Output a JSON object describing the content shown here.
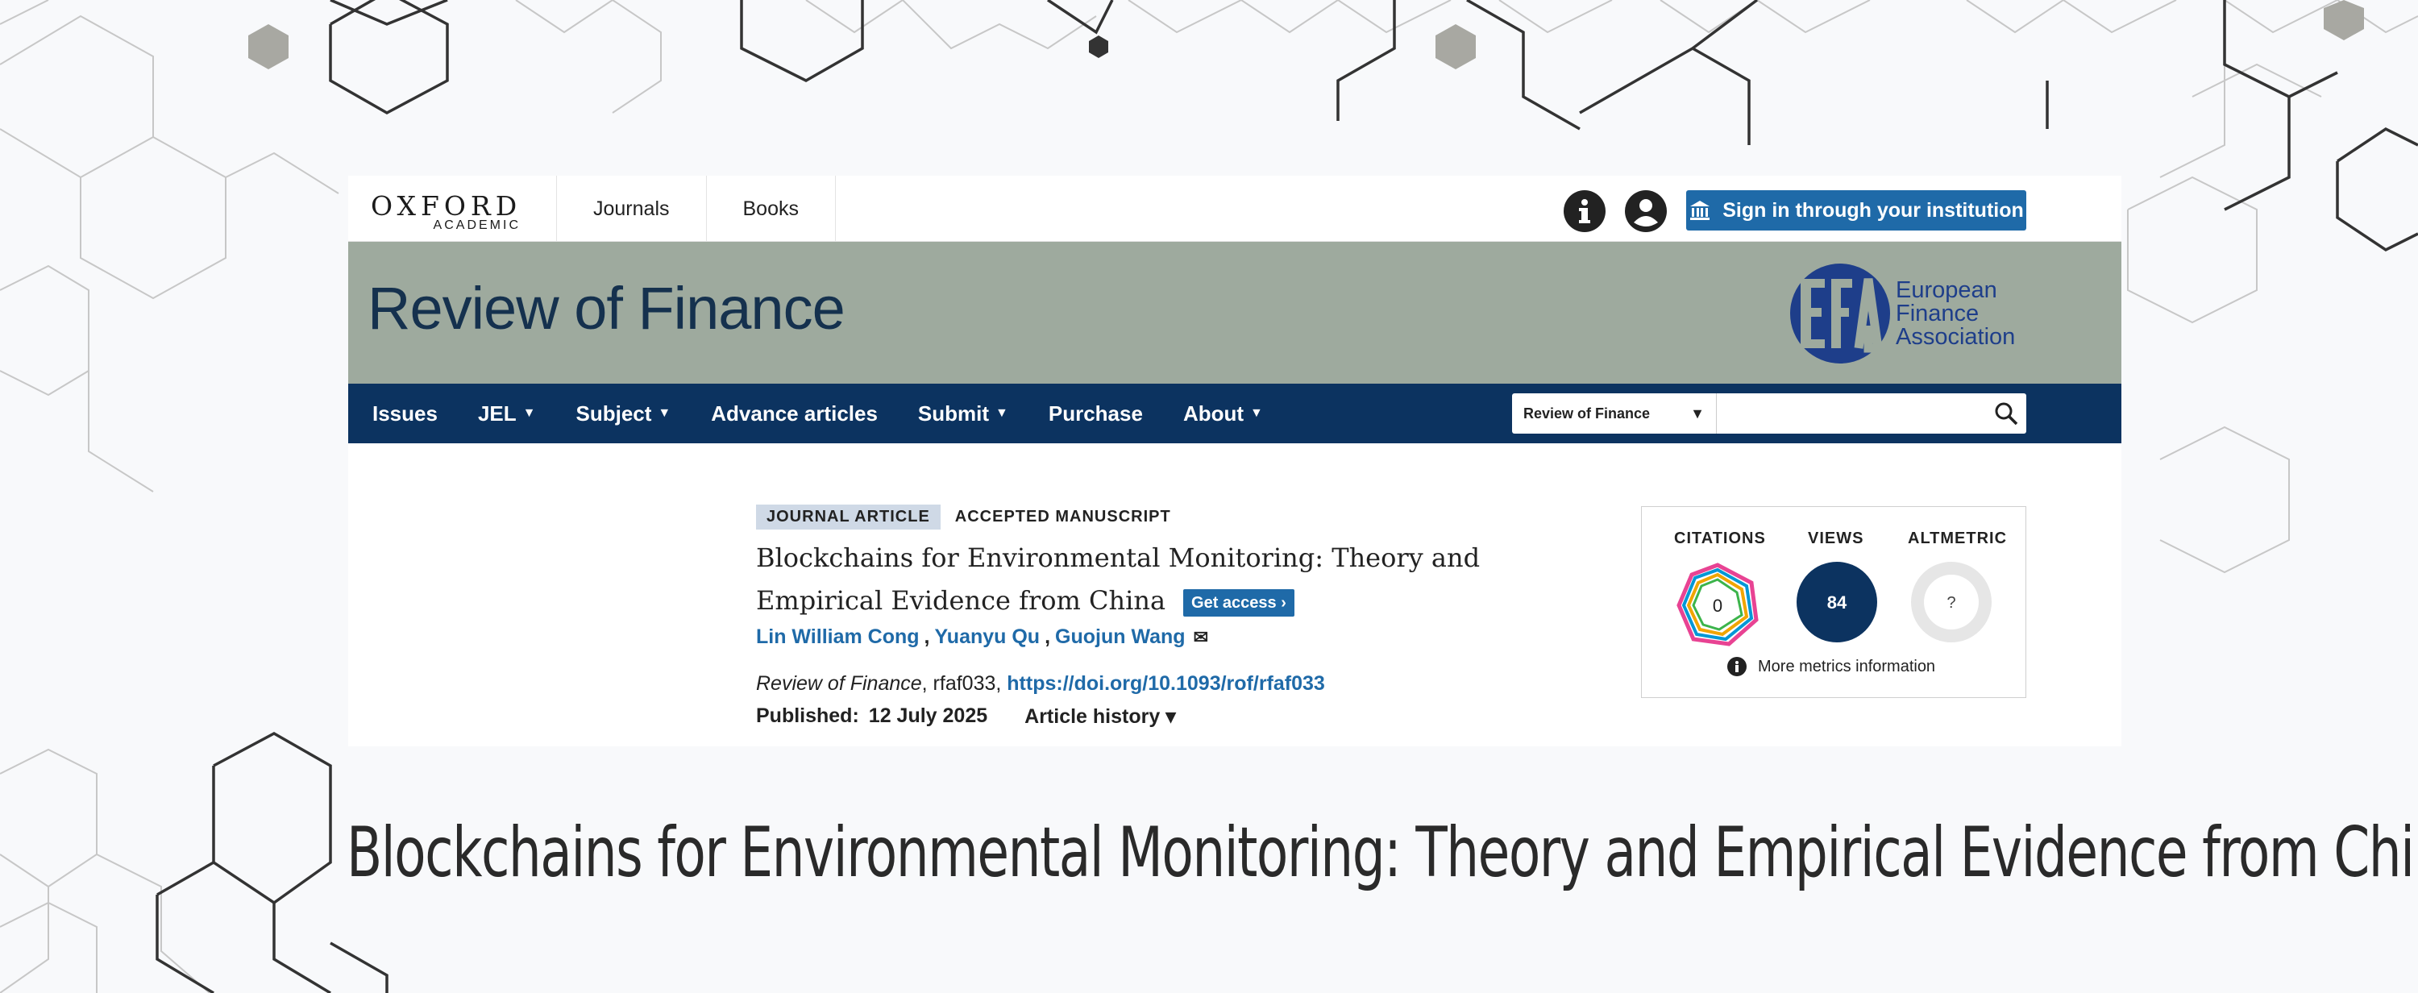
{
  "brand": {
    "name": "OXFORD",
    "sub": "ACADEMIC"
  },
  "topnav": {
    "items": [
      "Journals",
      "Books"
    ]
  },
  "signin": {
    "label": "Sign in through your institution"
  },
  "journal": {
    "title": "Review of Finance"
  },
  "partner": {
    "lines": [
      "European",
      "Finance",
      "Association"
    ],
    "mark": "EFA"
  },
  "nav": {
    "items": [
      {
        "label": "Issues",
        "dropdown": false
      },
      {
        "label": "JEL",
        "dropdown": true
      },
      {
        "label": "Subject",
        "dropdown": true
      },
      {
        "label": "Advance articles",
        "dropdown": false
      },
      {
        "label": "Submit",
        "dropdown": true
      },
      {
        "label": "Purchase",
        "dropdown": false
      },
      {
        "label": "About",
        "dropdown": true
      }
    ],
    "caret": "▼"
  },
  "search": {
    "scope": "Review of Finance",
    "value": ""
  },
  "article": {
    "type": "JOURNAL ARTICLE",
    "status": "ACCEPTED MANUSCRIPT",
    "title_line1": "Blockchains for Environmental Monitoring: Theory and",
    "title_line2": "Empirical Evidence from China",
    "get_access": "Get access",
    "authors": [
      "Lin William Cong",
      "Yuanyu Qu",
      "Guojun Wang"
    ],
    "author_sep": ",",
    "journal_name": "Review of Finance",
    "article_id": ", rfaf033, ",
    "doi": "https://doi.org/10.1093/rof/rfaf033",
    "published_label": "Published:",
    "published_date": "12 July 2025",
    "history_label": "Article history ▾"
  },
  "metrics": {
    "citations_label": "CITATIONS",
    "citations_value": "0",
    "views_label": "VIEWS",
    "views_value": "84",
    "altmetric_label": "ALTMETRIC",
    "altmetric_value": "?",
    "more": "More metrics information"
  },
  "caption": "Blockchains for Environmental Monitoring: Theory and Empirical Evidence from China",
  "colors": {
    "banner": "#9eaa9e",
    "navbar": "#0c3360",
    "accent": "#1f6aa8",
    "views_circle": "#0c3360"
  },
  "icons": [
    "info-icon",
    "user-icon",
    "institution-icon",
    "search-icon",
    "mail-icon",
    "chevron-right-icon",
    "dropdown-caret-icon"
  ]
}
